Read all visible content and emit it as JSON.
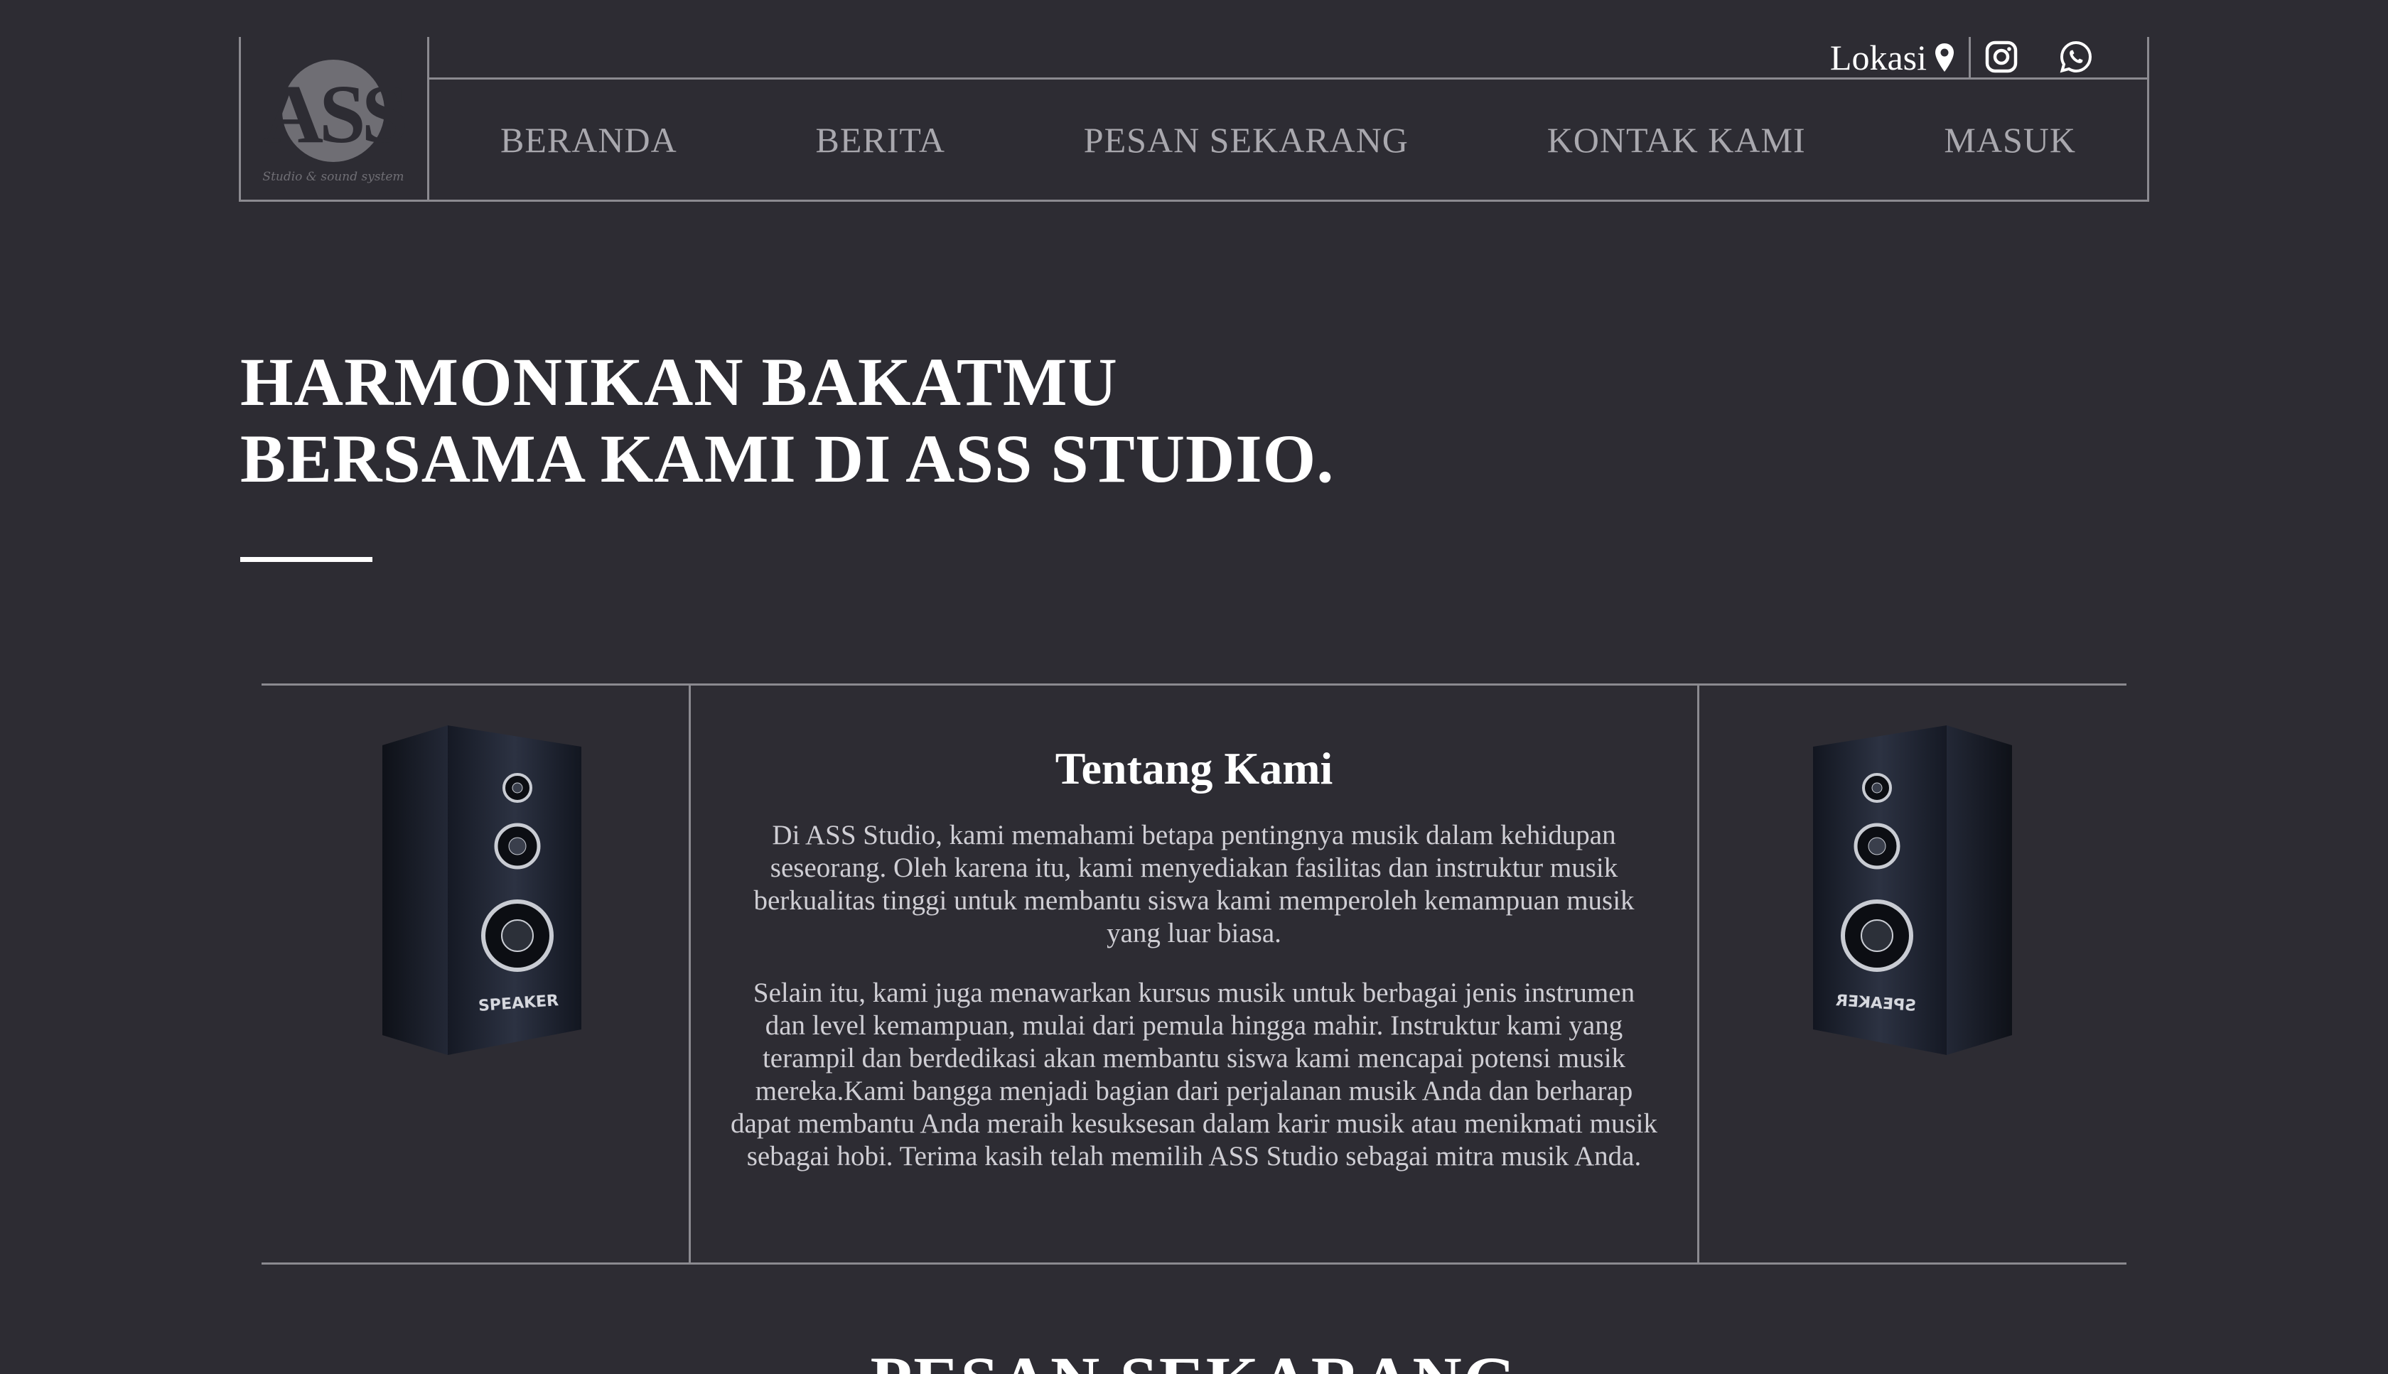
{
  "brand": {
    "logo_text": "ASS",
    "logo_tagline": "Studio & sound system"
  },
  "topbar": {
    "location_label": "Lokasi",
    "location_icon": "map-pin-icon",
    "social_icons": [
      "instagram-icon",
      "whatsapp-icon"
    ]
  },
  "nav": {
    "items": [
      "BERANDA",
      "BERITA",
      "PESAN SEKARANG",
      "KONTAK KAMI",
      "MASUK"
    ]
  },
  "hero": {
    "title_line1": "HARMONIKAN BAKATMU",
    "title_line2": "BERSAMA KAMI DI ASS STUDIO."
  },
  "about": {
    "heading": "Tentang Kami",
    "paragraph1": "Di ASS Studio, kami memahami betapa pentingnya musik dalam kehidupan seseorang. Oleh karena itu, kami menyediakan fasilitas dan instruktur musik berkualitas tinggi untuk membantu siswa kami memperoleh kemampuan musik yang luar biasa.",
    "paragraph2": "Selain itu, kami juga menawarkan kursus musik untuk berbagai jenis instrumen dan level kemampuan, mulai dari pemula hingga mahir. Instruktur kami yang terampil dan berdedikasi akan membantu siswa kami mencapai potensi musik mereka.Kami bangga menjadi bagian dari perjalanan musik Anda dan berharap dapat membantu Anda meraih kesuksesan dalam karir musik atau menikmati musik sebagai hobi. Terima kasih telah memilih ASS Studio sebagai mitra musik Anda.",
    "speaker_label": "SPEAKER"
  },
  "next_section": {
    "title": "PESAN SEKARANG"
  },
  "colors": {
    "background": "#2d2c33",
    "border": "#8b8a90",
    "nav_text": "#a9a8ae",
    "body_text": "#cfced4",
    "heading": "#ffffff"
  }
}
